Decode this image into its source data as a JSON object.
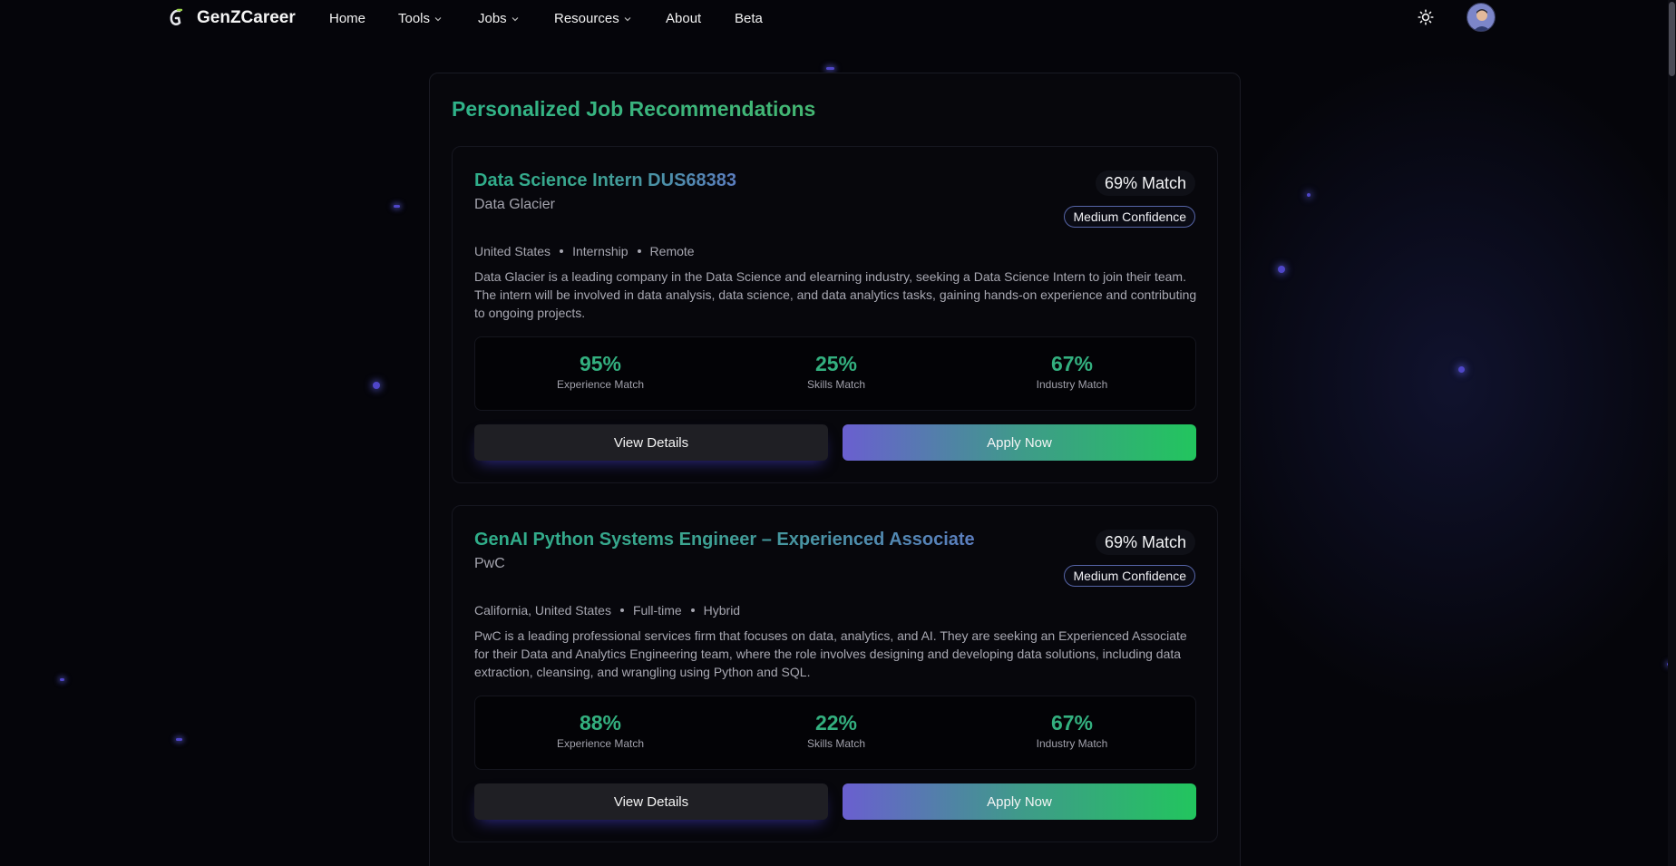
{
  "nav": {
    "brand": "GenZCareer",
    "items": [
      {
        "label": "Home",
        "has_dropdown": false
      },
      {
        "label": "Tools",
        "has_dropdown": true
      },
      {
        "label": "Jobs",
        "has_dropdown": true
      },
      {
        "label": "Resources",
        "has_dropdown": true
      },
      {
        "label": "About",
        "has_dropdown": false
      },
      {
        "label": "Beta",
        "has_dropdown": false
      }
    ],
    "theme_icon": "sun-icon",
    "avatar_icon": "user-avatar"
  },
  "page": {
    "title": "Personalized Job Recommendations"
  },
  "jobs": [
    {
      "title": "Data Science Intern DUS68383",
      "company": "Data Glacier",
      "match": "69% Match",
      "confidence": "Medium Confidence",
      "location": "United States",
      "type": "Internship",
      "mode": "Remote",
      "description": "Data Glacier is a leading company in the Data Science and elearning industry, seeking a Data Science Intern to join their team. The intern will be involved in data analysis, data science, and data analytics tasks, gaining hands-on experience and contributing to ongoing projects.",
      "stats": [
        {
          "value": "95%",
          "label": "Experience Match"
        },
        {
          "value": "25%",
          "label": "Skills Match"
        },
        {
          "value": "67%",
          "label": "Industry Match"
        }
      ],
      "view_label": "View Details",
      "apply_label": "Apply Now"
    },
    {
      "title": "GenAI Python Systems Engineer – Experienced Associate",
      "company": "PwC",
      "match": "69% Match",
      "confidence": "Medium Confidence",
      "location": "California, United States",
      "type": "Full-time",
      "mode": "Hybrid",
      "description": "PwC is a leading professional services firm that focuses on data, analytics, and AI. They are seeking an Experienced Associate for their Data and Analytics Engineering team, where the role involves designing and developing data solutions, including data extraction, cleansing, and wrangling using Python and SQL.",
      "stats": [
        {
          "value": "88%",
          "label": "Experience Match"
        },
        {
          "value": "22%",
          "label": "Skills Match"
        },
        {
          "value": "67%",
          "label": "Industry Match"
        }
      ],
      "view_label": "View Details",
      "apply_label": "Apply Now"
    }
  ],
  "colors": {
    "accent_green": "#22c55e",
    "accent_indigo": "#6a5fd0",
    "background": "#05050a"
  }
}
